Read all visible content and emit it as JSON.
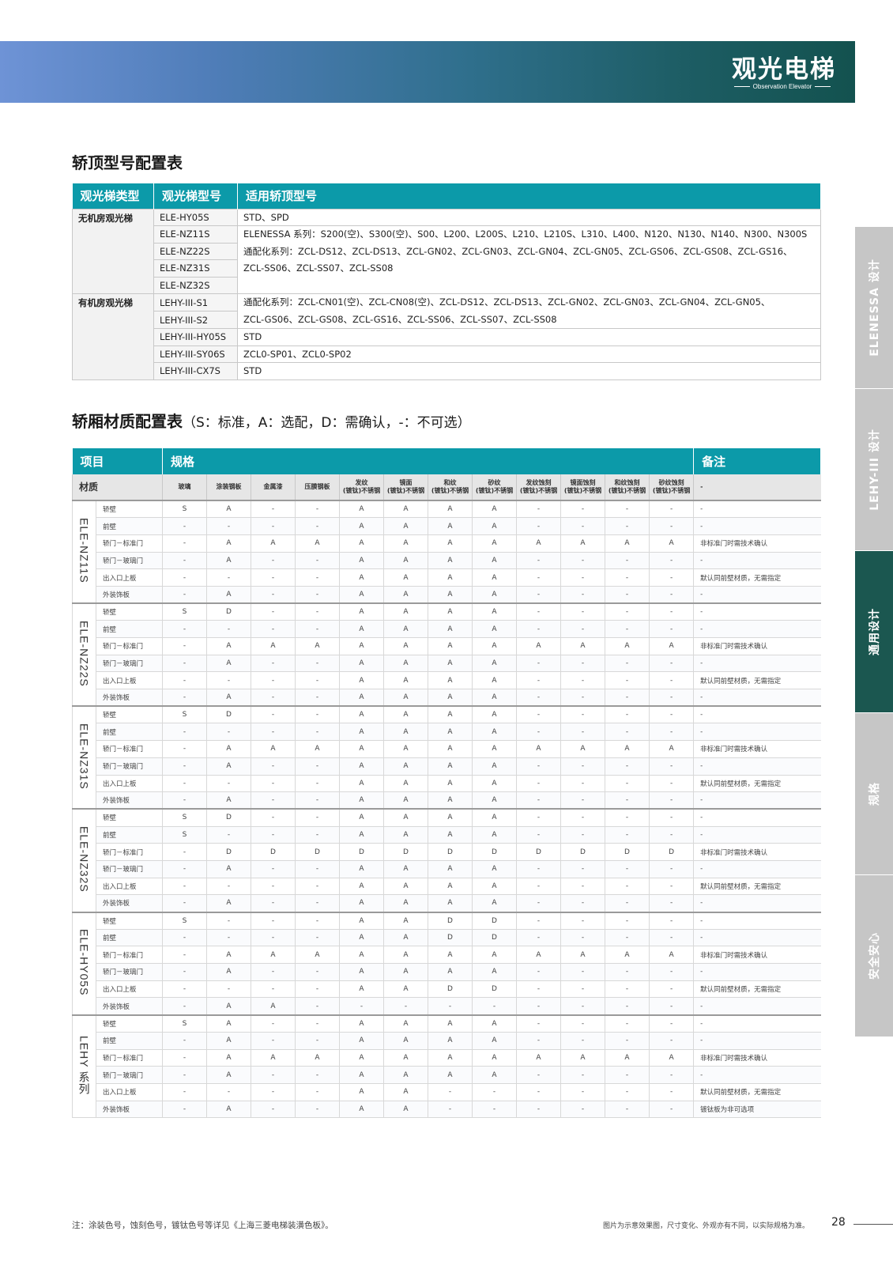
{
  "header": {
    "title": "观光电梯",
    "subtitle": "Observation Elevator"
  },
  "side_tabs": [
    "ELENESSA 设计",
    "LEHY-III 设计",
    "通用设计",
    "规格",
    "安全安心"
  ],
  "section1": {
    "title": "轿顶型号配置表",
    "headers": [
      "观光梯类型",
      "观光梯型号",
      "适用轿顶型号"
    ],
    "groups": [
      {
        "type": "无机房观光梯",
        "models": [
          "ELE-HY05S",
          "ELE-NZ11S",
          "ELE-NZ22S",
          "ELE-NZ31S",
          "ELE-NZ32S"
        ],
        "cars": [
          "STD、SPD",
          "ELENESSA 系列：S200(空)、S300(空)、S00、L200、L200S、L210、L210S、L310、L400、N120、N130、N140、N300、N300S\n通配化系列：ZCL-DS12、ZCL-DS13、ZCL-GN02、ZCL-GN03、ZCL-GN04、ZCL-GN05、ZCL-GS06、ZCL-GS08、ZCL-GS16、\nZCL-SS06、ZCL-SS07、ZCL-SS08"
        ]
      },
      {
        "type": "有机房观光梯",
        "models": [
          "LEHY-III-S1",
          "LEHY-III-S2",
          "LEHY-III-HY05S",
          "LEHY-III-SY06S",
          "LEHY-III-CX7S"
        ],
        "cars": [
          "通配化系列：ZCL-CN01(空)、ZCL-CN08(空)、ZCL-DS12、ZCL-DS13、ZCL-GN02、ZCL-GN03、ZCL-GN04、ZCL-GN05、\nZCL-GS06、ZCL-GS08、ZCL-GS16、ZCL-SS06、ZCL-SS07、ZCL-SS08",
          "STD",
          "ZCL0-SP01、ZCL0-SP02",
          "STD"
        ]
      }
    ]
  },
  "section2": {
    "title": "轿厢材质配置表",
    "note": "（S：标准，A：选配，D：需确认，-：不可选）",
    "header_item": "项目",
    "header_spec": "规格",
    "header_remark": "备注",
    "material_label": "材质",
    "columns": [
      "玻璃",
      "涂装钢板",
      "金属漆",
      "压膜钢板",
      "发纹\n(镀钛)不锈钢",
      "镜面\n(镀钛)不锈钢",
      "和纹\n(镀钛)不锈钢",
      "砂纹\n(镀钛)不锈钢",
      "发纹蚀刻\n(镀钛)不锈钢",
      "镜面蚀刻\n(镀钛)不锈钢",
      "和纹蚀刻\n(镀钛)不锈钢",
      "砂纹蚀刻\n(镀钛)不锈钢"
    ],
    "remark_header_value": "-",
    "groups": [
      {
        "name": "ELE-NZ11S",
        "rows": [
          {
            "part": "轿壁",
            "v": [
              "S",
              "A",
              "-",
              "-",
              "A",
              "A",
              "A",
              "A",
              "-",
              "-",
              "-",
              "-"
            ],
            "remark": "-"
          },
          {
            "part": "前壁",
            "v": [
              "-",
              "-",
              "-",
              "-",
              "A",
              "A",
              "A",
              "A",
              "-",
              "-",
              "-",
              "-"
            ],
            "remark": "-"
          },
          {
            "part": "轿门－标准门",
            "v": [
              "-",
              "A",
              "A",
              "A",
              "A",
              "A",
              "A",
              "A",
              "A",
              "A",
              "A",
              "A"
            ],
            "remark": "非标准门时需技术确认"
          },
          {
            "part": "轿门－玻璃门",
            "v": [
              "-",
              "A",
              "-",
              "-",
              "A",
              "A",
              "A",
              "A",
              "-",
              "-",
              "-",
              "-"
            ],
            "remark": "-"
          },
          {
            "part": "出入口上板",
            "v": [
              "-",
              "-",
              "-",
              "-",
              "A",
              "A",
              "A",
              "A",
              "-",
              "-",
              "-",
              "-"
            ],
            "remark": "默认同前壁材质，无需指定"
          },
          {
            "part": "外装饰板",
            "v": [
              "-",
              "A",
              "-",
              "-",
              "A",
              "A",
              "A",
              "A",
              "-",
              "-",
              "-",
              "-"
            ],
            "remark": "-"
          }
        ]
      },
      {
        "name": "ELE-NZ22S",
        "rows": [
          {
            "part": "轿壁",
            "v": [
              "S",
              "D",
              "-",
              "-",
              "A",
              "A",
              "A",
              "A",
              "-",
              "-",
              "-",
              "-"
            ],
            "remark": "-"
          },
          {
            "part": "前壁",
            "v": [
              "-",
              "-",
              "-",
              "-",
              "A",
              "A",
              "A",
              "A",
              "-",
              "-",
              "-",
              "-"
            ],
            "remark": "-"
          },
          {
            "part": "轿门－标准门",
            "v": [
              "-",
              "A",
              "A",
              "A",
              "A",
              "A",
              "A",
              "A",
              "A",
              "A",
              "A",
              "A"
            ],
            "remark": "非标准门时需技术确认"
          },
          {
            "part": "轿门－玻璃门",
            "v": [
              "-",
              "A",
              "-",
              "-",
              "A",
              "A",
              "A",
              "A",
              "-",
              "-",
              "-",
              "-"
            ],
            "remark": "-"
          },
          {
            "part": "出入口上板",
            "v": [
              "-",
              "-",
              "-",
              "-",
              "A",
              "A",
              "A",
              "A",
              "-",
              "-",
              "-",
              "-"
            ],
            "remark": "默认同前壁材质，无需指定"
          },
          {
            "part": "外装饰板",
            "v": [
              "-",
              "A",
              "-",
              "-",
              "A",
              "A",
              "A",
              "A",
              "-",
              "-",
              "-",
              "-"
            ],
            "remark": "-"
          }
        ]
      },
      {
        "name": "ELE-NZ31S",
        "rows": [
          {
            "part": "轿壁",
            "v": [
              "S",
              "D",
              "-",
              "-",
              "A",
              "A",
              "A",
              "A",
              "-",
              "-",
              "-",
              "-"
            ],
            "remark": "-"
          },
          {
            "part": "前壁",
            "v": [
              "-",
              "-",
              "-",
              "-",
              "A",
              "A",
              "A",
              "A",
              "-",
              "-",
              "-",
              "-"
            ],
            "remark": "-"
          },
          {
            "part": "轿门－标准门",
            "v": [
              "-",
              "A",
              "A",
              "A",
              "A",
              "A",
              "A",
              "A",
              "A",
              "A",
              "A",
              "A"
            ],
            "remark": "非标准门时需技术确认"
          },
          {
            "part": "轿门－玻璃门",
            "v": [
              "-",
              "A",
              "-",
              "-",
              "A",
              "A",
              "A",
              "A",
              "-",
              "-",
              "-",
              "-"
            ],
            "remark": "-"
          },
          {
            "part": "出入口上板",
            "v": [
              "-",
              "-",
              "-",
              "-",
              "A",
              "A",
              "A",
              "A",
              "-",
              "-",
              "-",
              "-"
            ],
            "remark": "默认同前壁材质，无需指定"
          },
          {
            "part": "外装饰板",
            "v": [
              "-",
              "A",
              "-",
              "-",
              "A",
              "A",
              "A",
              "A",
              "-",
              "-",
              "-",
              "-"
            ],
            "remark": "-"
          }
        ]
      },
      {
        "name": "ELE-NZ32S",
        "rows": [
          {
            "part": "轿壁",
            "v": [
              "S",
              "D",
              "-",
              "-",
              "A",
              "A",
              "A",
              "A",
              "-",
              "-",
              "-",
              "-"
            ],
            "remark": "-"
          },
          {
            "part": "前壁",
            "v": [
              "S",
              "-",
              "-",
              "-",
              "A",
              "A",
              "A",
              "A",
              "-",
              "-",
              "-",
              "-"
            ],
            "remark": "-"
          },
          {
            "part": "轿门－标准门",
            "v": [
              "-",
              "D",
              "D",
              "D",
              "D",
              "D",
              "D",
              "D",
              "D",
              "D",
              "D",
              "D"
            ],
            "remark": "非标准门时需技术确认"
          },
          {
            "part": "轿门－玻璃门",
            "v": [
              "-",
              "A",
              "-",
              "-",
              "A",
              "A",
              "A",
              "A",
              "-",
              "-",
              "-",
              "-"
            ],
            "remark": "-"
          },
          {
            "part": "出入口上板",
            "v": [
              "-",
              "-",
              "-",
              "-",
              "A",
              "A",
              "A",
              "A",
              "-",
              "-",
              "-",
              "-"
            ],
            "remark": "默认同前壁材质，无需指定"
          },
          {
            "part": "外装饰板",
            "v": [
              "-",
              "A",
              "-",
              "-",
              "A",
              "A",
              "A",
              "A",
              "-",
              "-",
              "-",
              "-"
            ],
            "remark": "-"
          }
        ]
      },
      {
        "name": "ELE-HY05S",
        "rows": [
          {
            "part": "轿壁",
            "v": [
              "S",
              "-",
              "-",
              "-",
              "A",
              "A",
              "D",
              "D",
              "-",
              "-",
              "-",
              "-"
            ],
            "remark": "-"
          },
          {
            "part": "前壁",
            "v": [
              "-",
              "-",
              "-",
              "-",
              "A",
              "A",
              "D",
              "D",
              "-",
              "-",
              "-",
              "-"
            ],
            "remark": "-"
          },
          {
            "part": "轿门－标准门",
            "v": [
              "-",
              "A",
              "A",
              "A",
              "A",
              "A",
              "A",
              "A",
              "A",
              "A",
              "A",
              "A"
            ],
            "remark": "非标准门时需技术确认"
          },
          {
            "part": "轿门－玻璃门",
            "v": [
              "-",
              "A",
              "-",
              "-",
              "A",
              "A",
              "A",
              "A",
              "-",
              "-",
              "-",
              "-"
            ],
            "remark": "-"
          },
          {
            "part": "出入口上板",
            "v": [
              "-",
              "-",
              "-",
              "-",
              "A",
              "A",
              "D",
              "D",
              "-",
              "-",
              "-",
              "-"
            ],
            "remark": "默认同前壁材质，无需指定"
          },
          {
            "part": "外装饰板",
            "v": [
              "-",
              "A",
              "A",
              "-",
              "-",
              "-",
              "-",
              "-",
              "-",
              "-",
              "-",
              "-"
            ],
            "remark": "-"
          }
        ]
      },
      {
        "name": "LEHY 系列",
        "rows": [
          {
            "part": "轿壁",
            "v": [
              "S",
              "A",
              "-",
              "-",
              "A",
              "A",
              "A",
              "A",
              "-",
              "-",
              "-",
              "-"
            ],
            "remark": "-"
          },
          {
            "part": "前壁",
            "v": [
              "-",
              "A",
              "-",
              "-",
              "A",
              "A",
              "A",
              "A",
              "-",
              "-",
              "-",
              "-"
            ],
            "remark": "-"
          },
          {
            "part": "轿门－标准门",
            "v": [
              "-",
              "A",
              "A",
              "A",
              "A",
              "A",
              "A",
              "A",
              "A",
              "A",
              "A",
              "A"
            ],
            "remark": "非标准门时需技术确认"
          },
          {
            "part": "轿门－玻璃门",
            "v": [
              "-",
              "A",
              "-",
              "-",
              "A",
              "A",
              "A",
              "A",
              "-",
              "-",
              "-",
              "-"
            ],
            "remark": "-"
          },
          {
            "part": "出入口上板",
            "v": [
              "-",
              "-",
              "-",
              "-",
              "A",
              "A",
              "-",
              "-",
              "-",
              "-",
              "-",
              "-"
            ],
            "remark": "默认同前壁材质，无需指定"
          },
          {
            "part": "外装饰板",
            "v": [
              "-",
              "A",
              "-",
              "-",
              "A",
              "A",
              "-",
              "-",
              "-",
              "-",
              "-",
              "-"
            ],
            "remark": "镀钛板为非可选项"
          }
        ]
      }
    ]
  },
  "footer": {
    "note": "注：涂装色号，蚀刻色号，镀钛色号等详见《上海三菱电梯装潢色板》。",
    "disclaimer": "图片为示意效果图，尺寸变化、外观亦有不同，以实际规格为准。",
    "page": "28"
  }
}
